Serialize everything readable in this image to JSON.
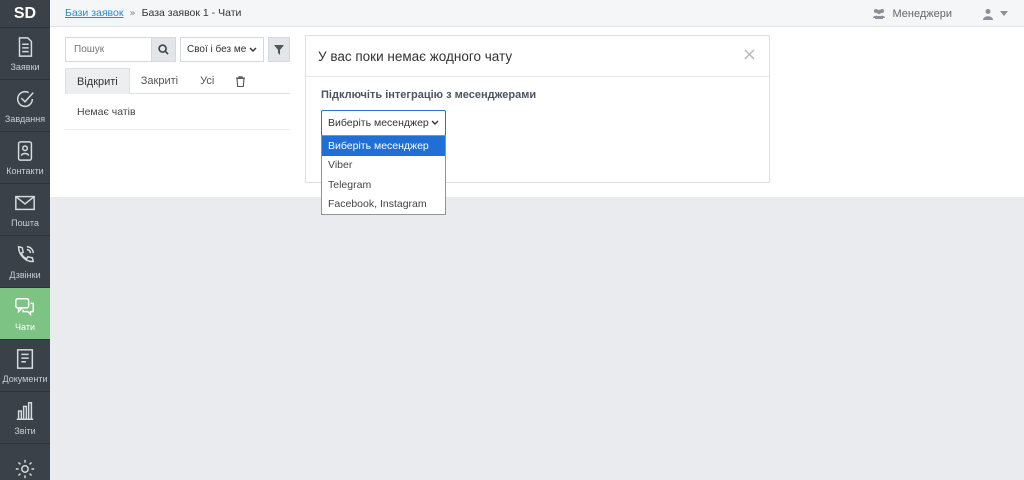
{
  "app": {
    "logo": "SD"
  },
  "sidebar": {
    "items": [
      {
        "label": "Заявки",
        "icon": "document-icon"
      },
      {
        "label": "Завдання",
        "icon": "check-circle-icon"
      },
      {
        "label": "Контакти",
        "icon": "contacts-icon"
      },
      {
        "label": "Пошта",
        "icon": "envelope-icon"
      },
      {
        "label": "Дзвінки",
        "icon": "phone-icon"
      },
      {
        "label": "Чати",
        "icon": "chat-icon",
        "active": true
      },
      {
        "label": "Документи",
        "icon": "documents-icon"
      },
      {
        "label": "Звіти",
        "icon": "bar-chart-icon"
      },
      {
        "label": "",
        "icon": "gear-icon"
      }
    ]
  },
  "breadcrumb": {
    "link": "Бази заявок",
    "separator": "»",
    "current": "База заявок 1 - Чати"
  },
  "topbar": {
    "managers": "Менеджери"
  },
  "search": {
    "placeholder": "Пошук",
    "filter_value": "Свої і без ме"
  },
  "tabs": [
    {
      "label": "Відкриті",
      "active": true
    },
    {
      "label": "Закриті"
    },
    {
      "label": "Усі"
    }
  ],
  "chat_list": {
    "empty_text": "Немає чатів"
  },
  "panel": {
    "title": "У вас поки немає жодного чату",
    "close": "×",
    "label": "Підключіть інтеграцію з месенджерами",
    "select_value": "Виберіть месенджер",
    "options": [
      "Виберіть месенджер",
      "Viber",
      "Telegram",
      "Facebook, Instagram"
    ]
  },
  "colors": {
    "sidebar": "#3a4149",
    "active": "#7dc383",
    "accent": "#1f6fd6",
    "link": "#2d8cc8"
  }
}
